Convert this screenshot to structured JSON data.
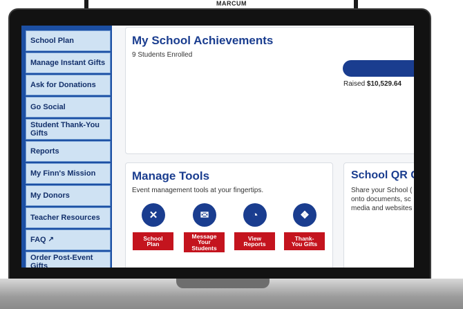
{
  "banner": {
    "text": "MARCUM"
  },
  "sidebar": {
    "items": [
      {
        "label": "School Plan"
      },
      {
        "label": "Manage Instant Gifts"
      },
      {
        "label": "Ask for Donations"
      },
      {
        "label": "Go Social"
      },
      {
        "label": "Student Thank-You Gifts"
      },
      {
        "label": "Reports"
      },
      {
        "label": "My Finn's Mission"
      },
      {
        "label": "My Donors"
      },
      {
        "label": "Teacher Resources"
      },
      {
        "label": "FAQ",
        "icon": "external-link-icon"
      },
      {
        "label": "Order Post-Event Gifts"
      }
    ]
  },
  "achievements": {
    "title": "My School Achievements",
    "enrolled": "9 Students Enrolled",
    "raised_label": "Raised",
    "raised_value": "$10,529.64"
  },
  "tools": {
    "title": "Manage Tools",
    "description": "Event management tools at your fingertips.",
    "buttons": [
      {
        "label": "School\nPlan",
        "icon": "school-plan-icon"
      },
      {
        "label": "Message\nYour\nStudents",
        "icon": "message-icon"
      },
      {
        "label": "View\nReports",
        "icon": "pie-chart-icon"
      },
      {
        "label": "Thank-\nYou Gifts",
        "icon": "gift-icon"
      }
    ]
  },
  "qr": {
    "title": "School QR C",
    "lines": [
      "Share your School (",
      "onto documents, sc",
      "media and websites"
    ]
  },
  "colors": {
    "brand_blue": "#1a3d8f",
    "sidebar_blue": "#1c4fa3",
    "sidebar_item_bg": "#cfe2f3",
    "button_red": "#c4141e"
  }
}
